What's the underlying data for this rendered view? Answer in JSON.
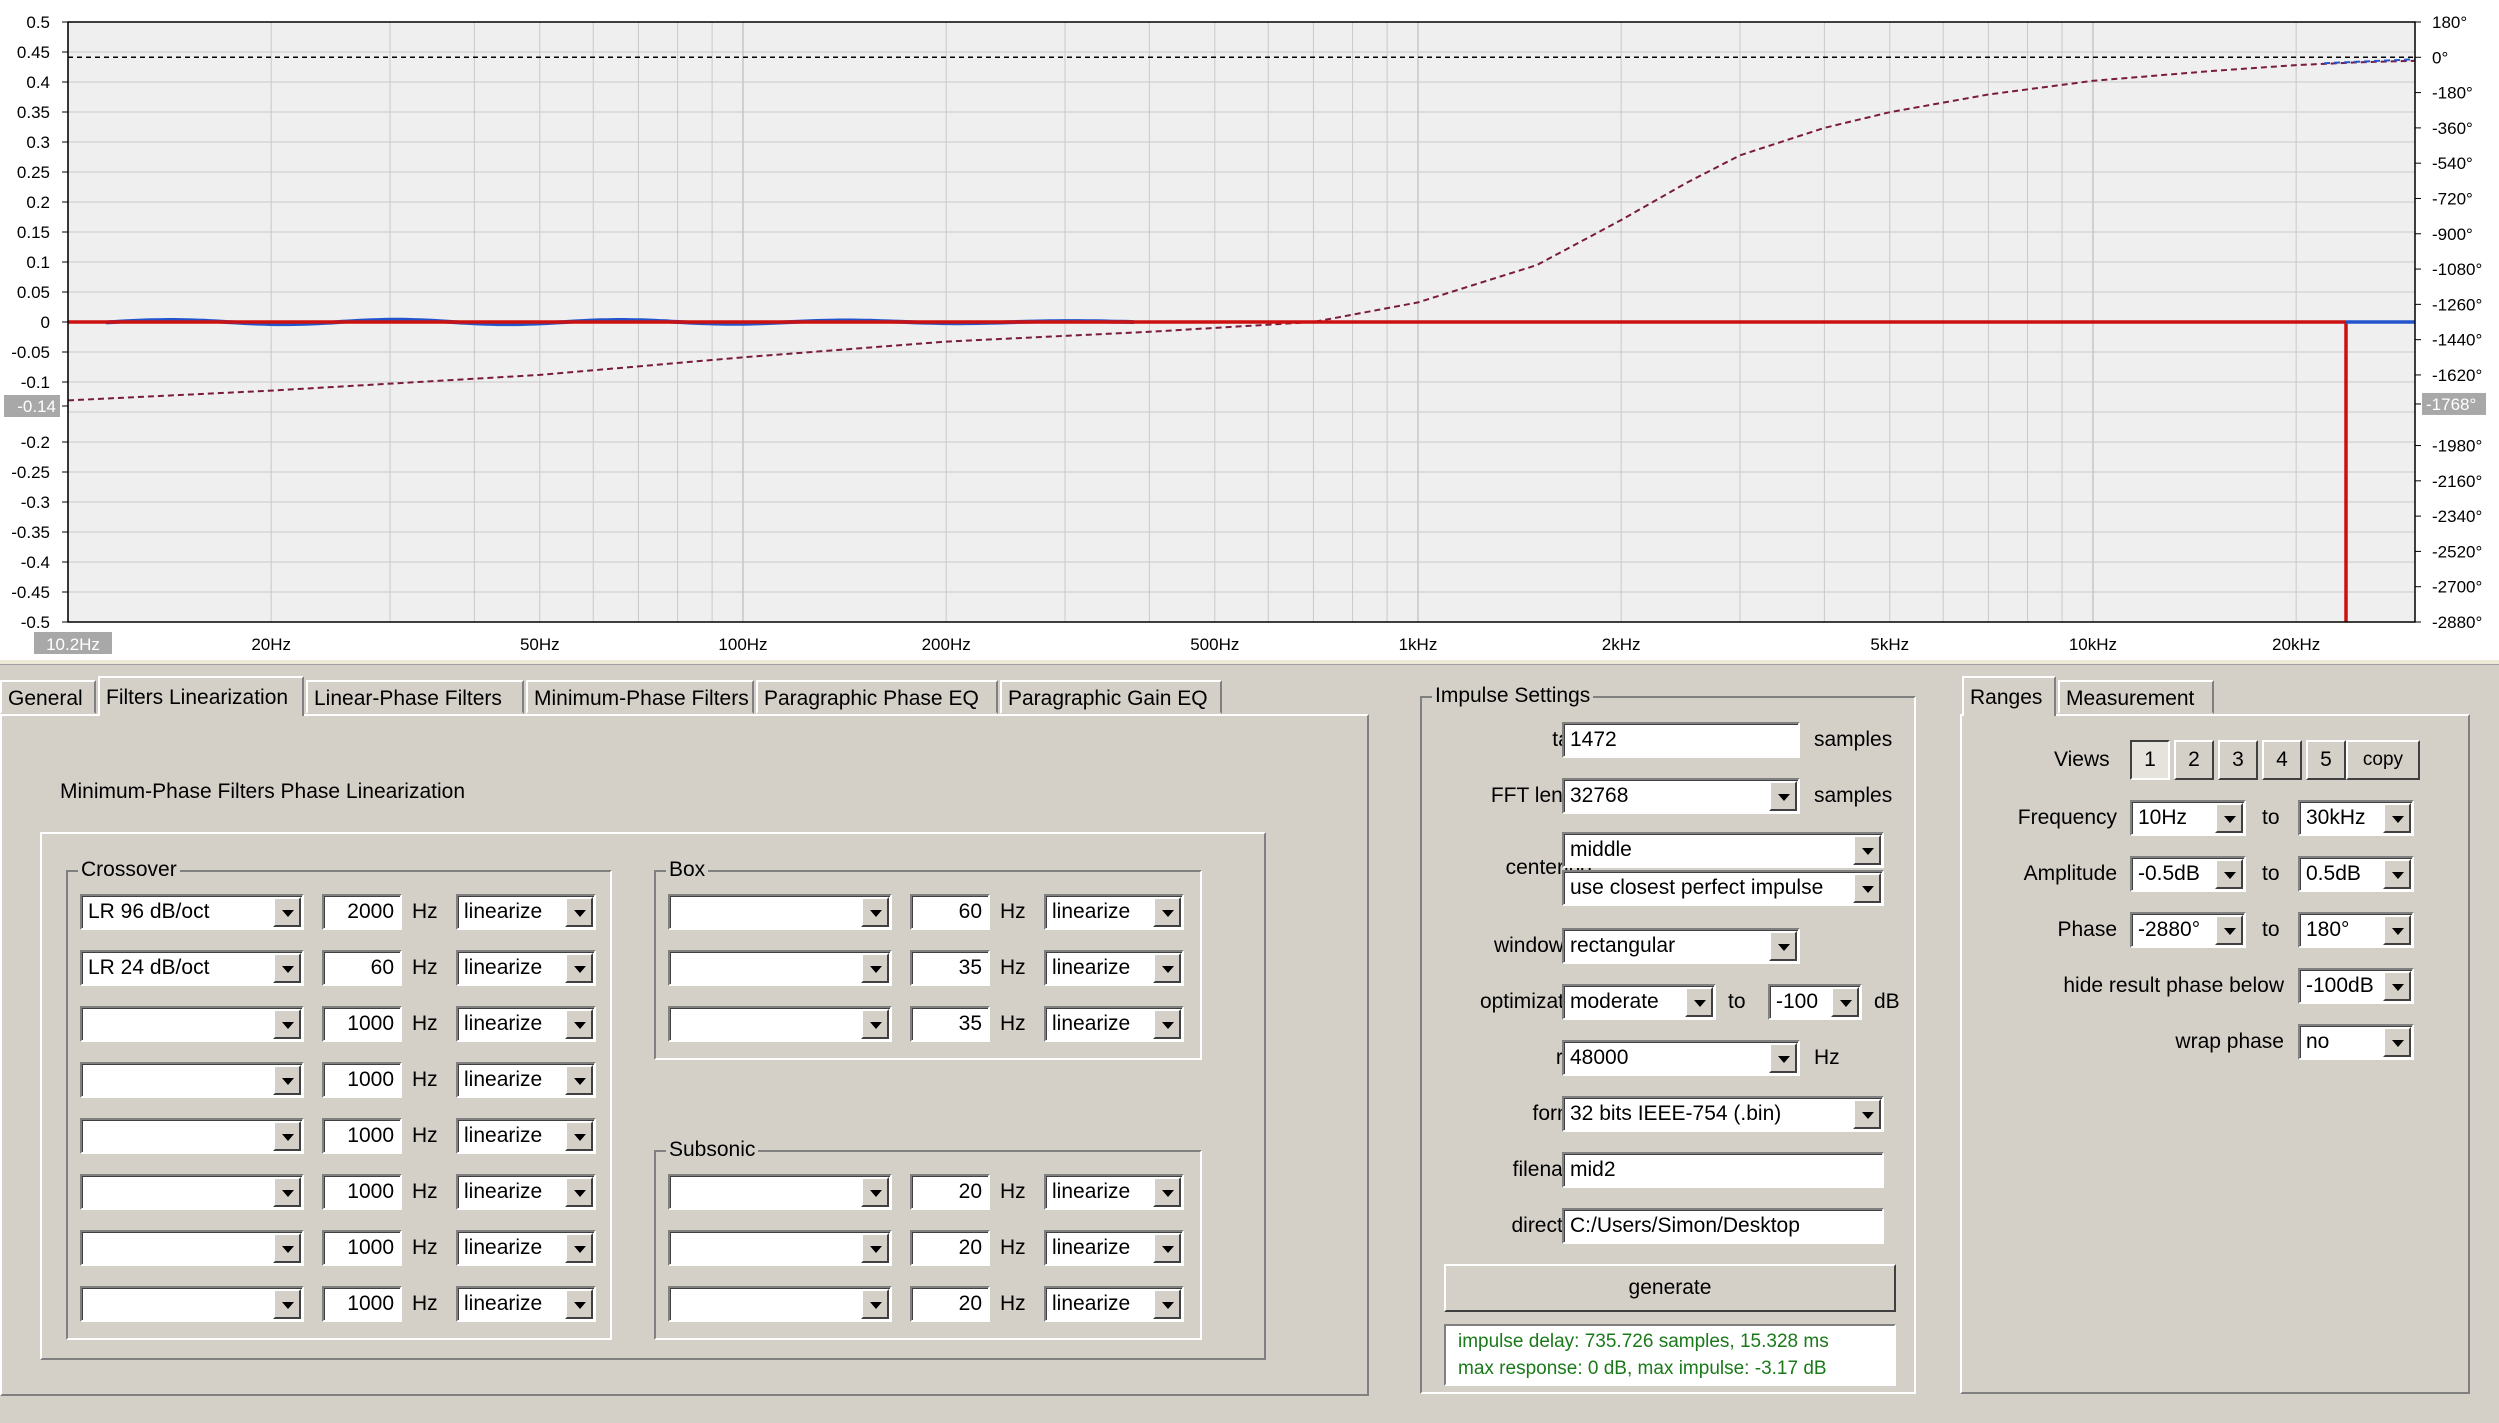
{
  "graph": {
    "left_axis": [
      "0.5",
      "0.45",
      "0.4",
      "0.35",
      "0.3",
      "0.25",
      "0.2",
      "0.15",
      "0.1",
      "0.05",
      "0",
      "-0.05",
      "-0.1",
      "-0.14",
      "-0.2",
      "-0.25",
      "-0.3",
      "-0.35",
      "-0.4",
      "-0.45",
      "-0.5"
    ],
    "right_axis": [
      "180°",
      "0°",
      "-180°",
      "-360°",
      "-540°",
      "-720°",
      "-900°",
      "-1080°",
      "-1260°",
      "-1440°",
      "-1620°",
      "-1768°",
      "-1980°",
      "-2160°",
      "-2340°",
      "-2520°",
      "-2700°",
      "-2880°"
    ],
    "x_ticks": [
      "10.2Hz",
      "20Hz",
      "50Hz",
      "100Hz",
      "200Hz",
      "500Hz",
      "1kHz",
      "2kHz",
      "5kHz",
      "10kHz",
      "20kHz"
    ],
    "cursor_left": "-0.14",
    "cursor_right": "-1768°",
    "cursor_x": "10.2Hz",
    "colors": {
      "magnitude": "#cc1010",
      "phase": "#7a1b3e",
      "blue": "#2255cc",
      "grid": "#c9c9c9",
      "plot_bg": "#efefef"
    }
  },
  "tabs": [
    "General",
    "Filters Linearization",
    "Linear-Phase Filters",
    "Minimum-Phase Filters",
    "Paragraphic Phase EQ",
    "Paragraphic Gain EQ"
  ],
  "active_tab": "Filters Linearization",
  "filters": {
    "heading": "Minimum-Phase Filters Phase Linearization",
    "crossover": {
      "title": "Crossover",
      "rows": [
        {
          "type": "LR  96 dB/oct",
          "freq": "2000",
          "unit": "Hz",
          "mode": "linearize"
        },
        {
          "type": "LR  24 dB/oct",
          "freq": "60",
          "unit": "Hz",
          "mode": "linearize"
        },
        {
          "type": "",
          "freq": "1000",
          "unit": "Hz",
          "mode": "linearize"
        },
        {
          "type": "",
          "freq": "1000",
          "unit": "Hz",
          "mode": "linearize"
        },
        {
          "type": "",
          "freq": "1000",
          "unit": "Hz",
          "mode": "linearize"
        },
        {
          "type": "",
          "freq": "1000",
          "unit": "Hz",
          "mode": "linearize"
        },
        {
          "type": "",
          "freq": "1000",
          "unit": "Hz",
          "mode": "linearize"
        },
        {
          "type": "",
          "freq": "1000",
          "unit": "Hz",
          "mode": "linearize"
        }
      ]
    },
    "box": {
      "title": "Box",
      "rows": [
        {
          "type": "",
          "freq": "60",
          "unit": "Hz",
          "mode": "linearize"
        },
        {
          "type": "",
          "freq": "35",
          "unit": "Hz",
          "mode": "linearize"
        },
        {
          "type": "",
          "freq": "35",
          "unit": "Hz",
          "mode": "linearize"
        }
      ]
    },
    "subsonic": {
      "title": "Subsonic",
      "rows": [
        {
          "type": "",
          "freq": "20",
          "unit": "Hz",
          "mode": "linearize"
        },
        {
          "type": "",
          "freq": "20",
          "unit": "Hz",
          "mode": "linearize"
        },
        {
          "type": "",
          "freq": "20",
          "unit": "Hz",
          "mode": "linearize"
        }
      ]
    }
  },
  "impulse": {
    "title": "Impulse Settings",
    "taps_label": "taps",
    "taps": "1472",
    "taps_unit": "samples",
    "fft_label": "FFT length",
    "fft": "32768",
    "fft_unit": "samples",
    "centering_label": "centering",
    "centering": "middle",
    "centering2": "use closest perfect impulse",
    "windowing_label": "windowing",
    "windowing": "rectangular",
    "optimization_label": "optimization",
    "optimization": "moderate",
    "opt_to": "to",
    "opt_db": "-100",
    "opt_unit": "dB",
    "rate_label": "rate",
    "rate": "48000",
    "rate_unit": "Hz",
    "format_label": "format",
    "format": "32 bits IEEE-754 (.bin)",
    "filename_label": "filename",
    "filename": "mid2",
    "directory_label": "directory",
    "directory": "C:/Users/Simon/Desktop",
    "generate": "generate",
    "status1": "impulse delay: 735.726 samples, 15.328 ms",
    "status2": "max response: 0 dB, max impulse: -3.17 dB"
  },
  "ranges": {
    "tabs": [
      "Ranges",
      "Measurement"
    ],
    "views_label": "Views",
    "views": [
      "1",
      "2",
      "3",
      "4",
      "5"
    ],
    "copy": "copy",
    "frequency_label": "Frequency",
    "freq_from": "10Hz",
    "freq_to": "30kHz",
    "amplitude_label": "Amplitude",
    "amp_from": "-0.5dB",
    "amp_to": "0.5dB",
    "phase_label": "Phase",
    "phase_from": "-2880°",
    "phase_to": "180°",
    "hide_label": "hide result phase below",
    "hide": "-100dB",
    "wrap_label": "wrap phase",
    "wrap": "no",
    "to": "to"
  }
}
